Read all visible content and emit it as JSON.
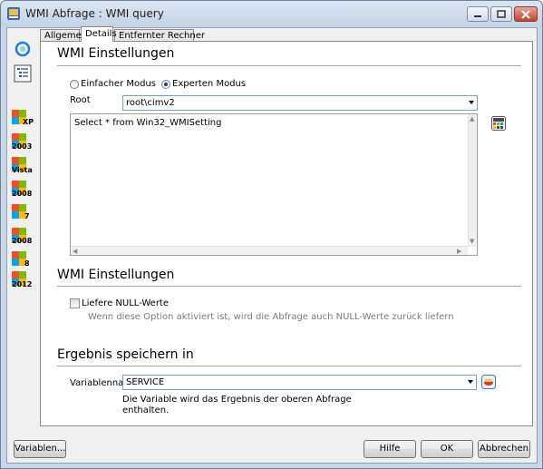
{
  "window": {
    "title": "WMI Abfrage : WMI query"
  },
  "tabs": [
    "Allgemein",
    "Details",
    "Entfernter Rechner"
  ],
  "os_list": [
    "XP",
    "2003",
    "Vista",
    "2008",
    "7",
    "2008",
    "8",
    "2012"
  ],
  "section1": {
    "title": "WMI Einstellungen",
    "mode_simple": "Einfacher Modus",
    "mode_expert": "Experten Modus",
    "selected_mode": "expert",
    "root_label": "Root",
    "root_value": "root\\cimv2",
    "query": "Select * from Win32_WMISetting"
  },
  "section2": {
    "title": "WMI Einstellungen",
    "null_label": "Liefere NULL-Werte",
    "null_checked": false,
    "null_hint": "Wenn diese Option aktiviert ist, wird die Abfrage auch NULL-Werte zurück liefern"
  },
  "section3": {
    "title": "Ergebnis speichern in",
    "var_label": "Variablenname",
    "var_value": "SERVICE",
    "var_hint_line1": "Die Variable wird das Ergebnis der oberen Abfrage",
    "var_hint_line2": "enthalten."
  },
  "buttons": {
    "variables": "Variablen...",
    "help": "Hilfe",
    "ok": "OK",
    "cancel": "Abbrechen"
  },
  "colors": {
    "accent": "#1e3d6b",
    "flag_red": "#f25022",
    "flag_green": "#7fba00",
    "flag_blue": "#00a4ef",
    "flag_yellow": "#ffb900"
  }
}
